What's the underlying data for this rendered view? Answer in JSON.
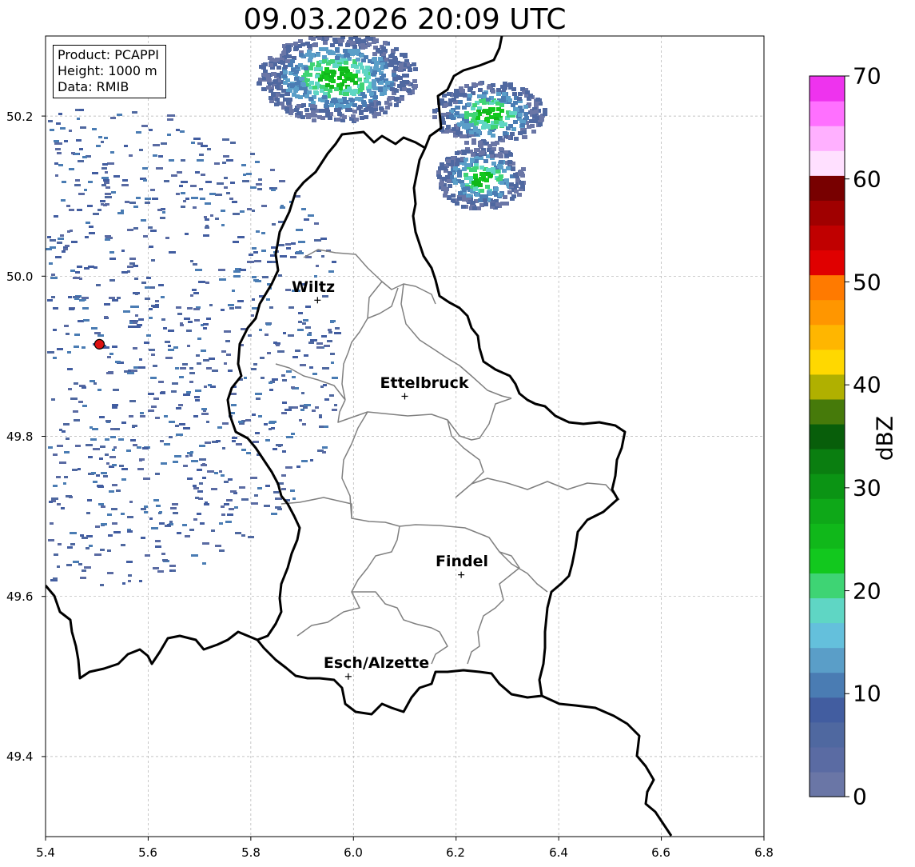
{
  "title": "09.03.2026 20:09 UTC",
  "info": {
    "product": "Product: PCAPPI",
    "height": "Height: 1000 m",
    "data": "Data: RMIB"
  },
  "axes": {
    "x_ticks": [
      "5.4",
      "5.6",
      "5.8",
      "6.0",
      "6.2",
      "6.4",
      "6.6",
      "6.8"
    ],
    "y_ticks": [
      "49.4",
      "49.6",
      "49.8",
      "50.0",
      "50.2"
    ],
    "x_range": [
      5.4,
      6.8
    ],
    "y_range": [
      49.3,
      50.3
    ]
  },
  "cities": [
    {
      "name": "Wiltz",
      "lon": 5.93,
      "lat": 49.97
    },
    {
      "name": "Ettelbruck",
      "lon": 6.1,
      "lat": 49.85
    },
    {
      "name": "Findel",
      "lon": 6.21,
      "lat": 49.627
    },
    {
      "name": "Esch/Alzette",
      "lon": 5.99,
      "lat": 49.5
    }
  ],
  "radar_site": {
    "lon": 5.505,
    "lat": 49.915,
    "color": "#dd1111"
  },
  "colorbar": {
    "label": "dBZ",
    "ticks": [
      "0",
      "10",
      "20",
      "30",
      "40",
      "50",
      "60",
      "70"
    ],
    "range": [
      0,
      70
    ],
    "colors": [
      "#6a76a6",
      "#5a6ba3",
      "#4f68a0",
      "#425da0",
      "#4a7cb3",
      "#5a9ec8",
      "#64c0dc",
      "#5fd6c4",
      "#3ed474",
      "#12c81e",
      "#10b81a",
      "#0ea818",
      "#0b9414",
      "#0a7e10",
      "#085e0a",
      "#467a0a",
      "#b0b000",
      "#ffd800",
      "#ffb600",
      "#ff9600",
      "#ff7a00",
      "#e00000",
      "#c00000",
      "#a00000",
      "#780000",
      "#ffe0ff",
      "#ffb0ff",
      "#ff70ff",
      "#ee33ee"
    ]
  }
}
